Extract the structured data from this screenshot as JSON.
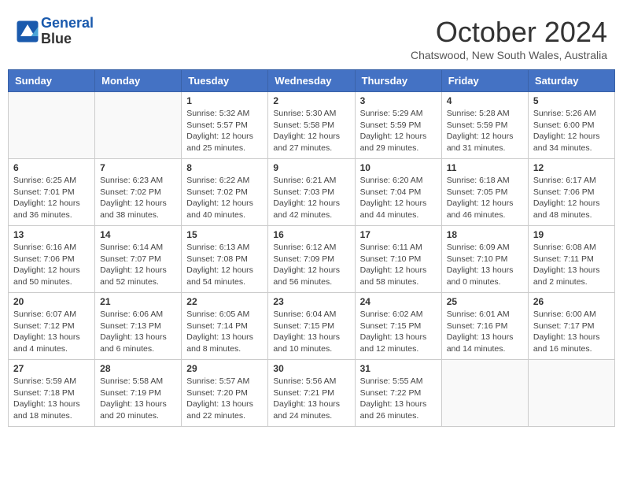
{
  "header": {
    "logo_line1": "General",
    "logo_line2": "Blue",
    "month": "October 2024",
    "location": "Chatswood, New South Wales, Australia"
  },
  "weekdays": [
    "Sunday",
    "Monday",
    "Tuesday",
    "Wednesday",
    "Thursday",
    "Friday",
    "Saturday"
  ],
  "weeks": [
    [
      {
        "day": "",
        "info": ""
      },
      {
        "day": "",
        "info": ""
      },
      {
        "day": "1",
        "info": "Sunrise: 5:32 AM\nSunset: 5:57 PM\nDaylight: 12 hours\nand 25 minutes."
      },
      {
        "day": "2",
        "info": "Sunrise: 5:30 AM\nSunset: 5:58 PM\nDaylight: 12 hours\nand 27 minutes."
      },
      {
        "day": "3",
        "info": "Sunrise: 5:29 AM\nSunset: 5:59 PM\nDaylight: 12 hours\nand 29 minutes."
      },
      {
        "day": "4",
        "info": "Sunrise: 5:28 AM\nSunset: 5:59 PM\nDaylight: 12 hours\nand 31 minutes."
      },
      {
        "day": "5",
        "info": "Sunrise: 5:26 AM\nSunset: 6:00 PM\nDaylight: 12 hours\nand 34 minutes."
      }
    ],
    [
      {
        "day": "6",
        "info": "Sunrise: 6:25 AM\nSunset: 7:01 PM\nDaylight: 12 hours\nand 36 minutes."
      },
      {
        "day": "7",
        "info": "Sunrise: 6:23 AM\nSunset: 7:02 PM\nDaylight: 12 hours\nand 38 minutes."
      },
      {
        "day": "8",
        "info": "Sunrise: 6:22 AM\nSunset: 7:02 PM\nDaylight: 12 hours\nand 40 minutes."
      },
      {
        "day": "9",
        "info": "Sunrise: 6:21 AM\nSunset: 7:03 PM\nDaylight: 12 hours\nand 42 minutes."
      },
      {
        "day": "10",
        "info": "Sunrise: 6:20 AM\nSunset: 7:04 PM\nDaylight: 12 hours\nand 44 minutes."
      },
      {
        "day": "11",
        "info": "Sunrise: 6:18 AM\nSunset: 7:05 PM\nDaylight: 12 hours\nand 46 minutes."
      },
      {
        "day": "12",
        "info": "Sunrise: 6:17 AM\nSunset: 7:06 PM\nDaylight: 12 hours\nand 48 minutes."
      }
    ],
    [
      {
        "day": "13",
        "info": "Sunrise: 6:16 AM\nSunset: 7:06 PM\nDaylight: 12 hours\nand 50 minutes."
      },
      {
        "day": "14",
        "info": "Sunrise: 6:14 AM\nSunset: 7:07 PM\nDaylight: 12 hours\nand 52 minutes."
      },
      {
        "day": "15",
        "info": "Sunrise: 6:13 AM\nSunset: 7:08 PM\nDaylight: 12 hours\nand 54 minutes."
      },
      {
        "day": "16",
        "info": "Sunrise: 6:12 AM\nSunset: 7:09 PM\nDaylight: 12 hours\nand 56 minutes."
      },
      {
        "day": "17",
        "info": "Sunrise: 6:11 AM\nSunset: 7:10 PM\nDaylight: 12 hours\nand 58 minutes."
      },
      {
        "day": "18",
        "info": "Sunrise: 6:09 AM\nSunset: 7:10 PM\nDaylight: 13 hours\nand 0 minutes."
      },
      {
        "day": "19",
        "info": "Sunrise: 6:08 AM\nSunset: 7:11 PM\nDaylight: 13 hours\nand 2 minutes."
      }
    ],
    [
      {
        "day": "20",
        "info": "Sunrise: 6:07 AM\nSunset: 7:12 PM\nDaylight: 13 hours\nand 4 minutes."
      },
      {
        "day": "21",
        "info": "Sunrise: 6:06 AM\nSunset: 7:13 PM\nDaylight: 13 hours\nand 6 minutes."
      },
      {
        "day": "22",
        "info": "Sunrise: 6:05 AM\nSunset: 7:14 PM\nDaylight: 13 hours\nand 8 minutes."
      },
      {
        "day": "23",
        "info": "Sunrise: 6:04 AM\nSunset: 7:15 PM\nDaylight: 13 hours\nand 10 minutes."
      },
      {
        "day": "24",
        "info": "Sunrise: 6:02 AM\nSunset: 7:15 PM\nDaylight: 13 hours\nand 12 minutes."
      },
      {
        "day": "25",
        "info": "Sunrise: 6:01 AM\nSunset: 7:16 PM\nDaylight: 13 hours\nand 14 minutes."
      },
      {
        "day": "26",
        "info": "Sunrise: 6:00 AM\nSunset: 7:17 PM\nDaylight: 13 hours\nand 16 minutes."
      }
    ],
    [
      {
        "day": "27",
        "info": "Sunrise: 5:59 AM\nSunset: 7:18 PM\nDaylight: 13 hours\nand 18 minutes."
      },
      {
        "day": "28",
        "info": "Sunrise: 5:58 AM\nSunset: 7:19 PM\nDaylight: 13 hours\nand 20 minutes."
      },
      {
        "day": "29",
        "info": "Sunrise: 5:57 AM\nSunset: 7:20 PM\nDaylight: 13 hours\nand 22 minutes."
      },
      {
        "day": "30",
        "info": "Sunrise: 5:56 AM\nSunset: 7:21 PM\nDaylight: 13 hours\nand 24 minutes."
      },
      {
        "day": "31",
        "info": "Sunrise: 5:55 AM\nSunset: 7:22 PM\nDaylight: 13 hours\nand 26 minutes."
      },
      {
        "day": "",
        "info": ""
      },
      {
        "day": "",
        "info": ""
      }
    ]
  ]
}
